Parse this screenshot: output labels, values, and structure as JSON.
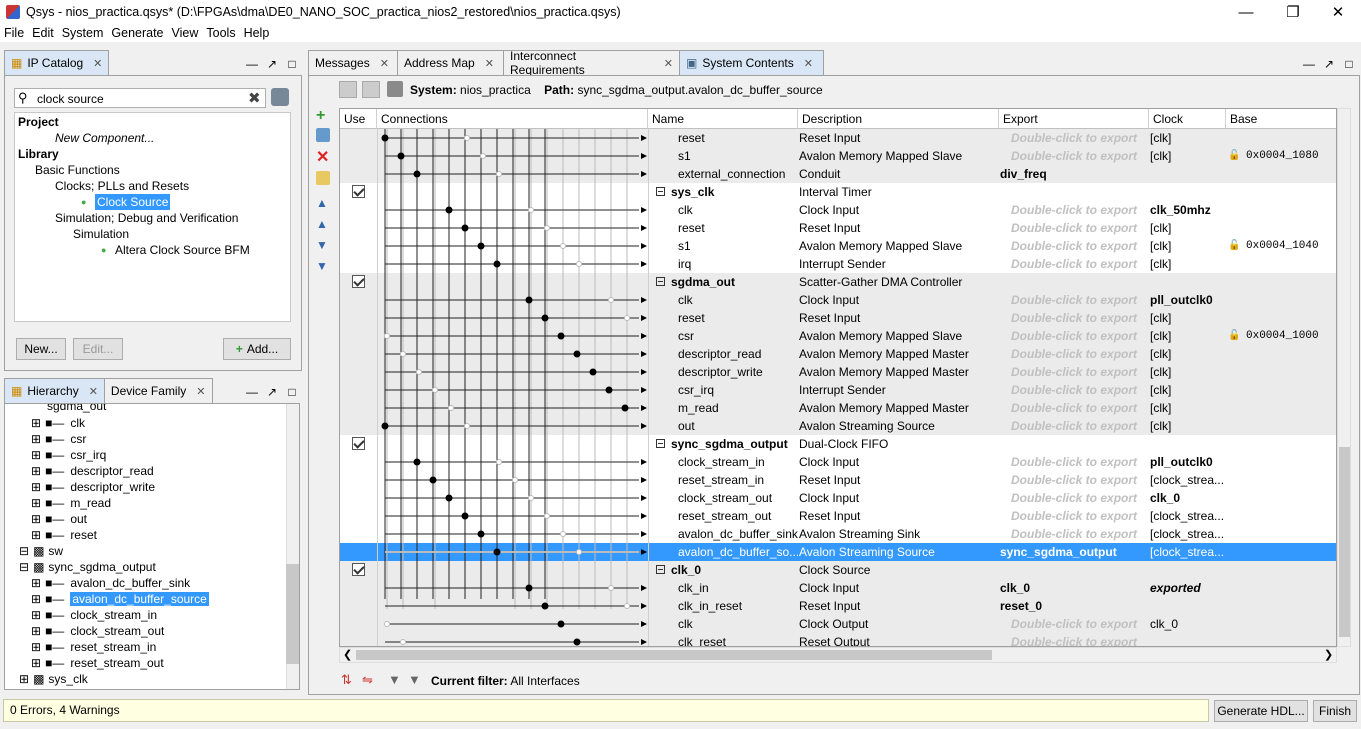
{
  "window": {
    "title": "Qsys - nios_practica.qsys* (D:\\FPGAs\\dma\\DE0_NANO_SOC_practica_nios2_restored\\nios_practica.qsys)"
  },
  "menu": [
    "File",
    "Edit",
    "System",
    "Generate",
    "View",
    "Tools",
    "Help"
  ],
  "ip_catalog": {
    "tab": "IP Catalog",
    "search_value": "clock source",
    "project_label": "Project",
    "new_component": "New Component...",
    "library_label": "Library",
    "basic_functions": "Basic Functions",
    "clocks_group": "Clocks; PLLs and Resets",
    "clock_source": "Clock Source",
    "sim_group": "Simulation; Debug and Verification",
    "simulation": "Simulation",
    "bfm": "Altera Clock Source BFM",
    "new_btn": "New...",
    "edit_btn": "Edit...",
    "add_btn": "Add..."
  },
  "hierarchy": {
    "tab1": "Hierarchy",
    "tab2": "Device Family",
    "top_partial": "sgdma_out",
    "items": [
      "clk",
      "csr",
      "csr_irq",
      "descriptor_read",
      "descriptor_write",
      "m_read",
      "out",
      "reset"
    ],
    "sw": "sw",
    "sync": "sync_sgdma_output",
    "sync_items": [
      "avalon_dc_buffer_sink",
      "avalon_dc_buffer_source",
      "clock_stream_in",
      "clock_stream_out",
      "reset_stream_in",
      "reset_stream_out"
    ],
    "sys_clk": "sys_clk"
  },
  "tabs": [
    "Messages",
    "Address Map",
    "Interconnect Requirements",
    "System Contents"
  ],
  "system": {
    "label": "System:",
    "name": "nios_practica",
    "path_label": "Path:",
    "path": "sync_sgdma_output.avalon_dc_buffer_source"
  },
  "columns": [
    "Use",
    "Connections",
    "Name",
    "Description",
    "Export",
    "Clock",
    "Base"
  ],
  "dc": "Double-click to export",
  "rows": [
    {
      "name": "reset",
      "desc": "Reset Input",
      "export": "",
      "clock": "[clk]",
      "base": "",
      "g": true
    },
    {
      "name": "s1",
      "desc": "Avalon Memory Mapped Slave",
      "export": "",
      "clock": "[clk]",
      "base": "0x0004_1080",
      "g": true
    },
    {
      "name": "external_connection",
      "desc": "Conduit",
      "export": "div_freq",
      "clock": "",
      "base": "",
      "g": true
    },
    {
      "name": "sys_clk",
      "desc": "Interval Timer",
      "export": "",
      "clock": "",
      "base": "",
      "comp": true,
      "g": false
    },
    {
      "name": "clk",
      "desc": "Clock Input",
      "export": "",
      "clock": "clk_50mhz",
      "clockbold": true,
      "base": "",
      "g": false
    },
    {
      "name": "reset",
      "desc": "Reset Input",
      "export": "",
      "clock": "[clk]",
      "base": "",
      "g": false
    },
    {
      "name": "s1",
      "desc": "Avalon Memory Mapped Slave",
      "export": "",
      "clock": "[clk]",
      "base": "0x0004_1040",
      "g": false
    },
    {
      "name": "irq",
      "desc": "Interrupt Sender",
      "export": "",
      "clock": "[clk]",
      "base": "",
      "g": false
    },
    {
      "name": "sgdma_out",
      "desc": "Scatter-Gather DMA Controller",
      "export": "",
      "clock": "",
      "base": "",
      "comp": true,
      "g": true
    },
    {
      "name": "clk",
      "desc": "Clock Input",
      "export": "",
      "clock": "pll_outclk0",
      "clockbold": true,
      "base": "",
      "g": true
    },
    {
      "name": "reset",
      "desc": "Reset Input",
      "export": "",
      "clock": "[clk]",
      "base": "",
      "g": true
    },
    {
      "name": "csr",
      "desc": "Avalon Memory Mapped Slave",
      "export": "",
      "clock": "[clk]",
      "base": "0x0004_1000",
      "g": true
    },
    {
      "name": "descriptor_read",
      "desc": "Avalon Memory Mapped Master",
      "export": "",
      "clock": "[clk]",
      "base": "",
      "g": true
    },
    {
      "name": "descriptor_write",
      "desc": "Avalon Memory Mapped Master",
      "export": "",
      "clock": "[clk]",
      "base": "",
      "g": true
    },
    {
      "name": "csr_irq",
      "desc": "Interrupt Sender",
      "export": "",
      "clock": "[clk]",
      "base": "",
      "g": true
    },
    {
      "name": "m_read",
      "desc": "Avalon Memory Mapped Master",
      "export": "",
      "clock": "[clk]",
      "base": "",
      "g": true
    },
    {
      "name": "out",
      "desc": "Avalon Streaming Source",
      "export": "",
      "clock": "[clk]",
      "base": "",
      "g": true
    },
    {
      "name": "sync_sgdma_output",
      "desc": "Dual-Clock FIFO",
      "export": "",
      "clock": "",
      "base": "",
      "comp": true,
      "g": false
    },
    {
      "name": "clock_stream_in",
      "desc": "Clock Input",
      "export": "",
      "clock": "pll_outclk0",
      "clockbold": true,
      "base": "",
      "g": false
    },
    {
      "name": "reset_stream_in",
      "desc": "Reset Input",
      "export": "",
      "clock": "[clock_strea...",
      "base": "",
      "g": false
    },
    {
      "name": "clock_stream_out",
      "desc": "Clock Input",
      "export": "",
      "clock": "clk_0",
      "clockbold": true,
      "base": "",
      "g": false
    },
    {
      "name": "reset_stream_out",
      "desc": "Reset Input",
      "export": "",
      "clock": "[clock_strea...",
      "base": "",
      "g": false
    },
    {
      "name": "avalon_dc_buffer_sink",
      "desc": "Avalon Streaming Sink",
      "export": "",
      "clock": "[clock_strea...",
      "base": "",
      "g": false
    },
    {
      "name": "avalon_dc_buffer_so...",
      "desc": "Avalon Streaming Source",
      "export": "sync_sgdma_output",
      "clock": "[clock_strea...",
      "base": "",
      "hl": true
    },
    {
      "name": "clk_0",
      "desc": "Clock Source",
      "export": "",
      "clock": "",
      "base": "",
      "comp": true,
      "g": true
    },
    {
      "name": "clk_in",
      "desc": "Clock Input",
      "export": "clk_0",
      "clock": "exported",
      "clockital": true,
      "base": "",
      "g": true
    },
    {
      "name": "clk_in_reset",
      "desc": "Reset Input",
      "export": "reset_0",
      "clock": "",
      "base": "",
      "g": true
    },
    {
      "name": "clk",
      "desc": "Clock Output",
      "export": "",
      "clock": "clk_0",
      "base": "",
      "g": true
    },
    {
      "name": "clk_reset",
      "desc": "Reset Output",
      "export": "",
      "clock": "",
      "base": "",
      "g": true
    }
  ],
  "filter": {
    "label": "Current filter:",
    "value": "All Interfaces"
  },
  "status": "0 Errors, 4 Warnings",
  "buttons": {
    "generate": "Generate HDL...",
    "finish": "Finish"
  }
}
